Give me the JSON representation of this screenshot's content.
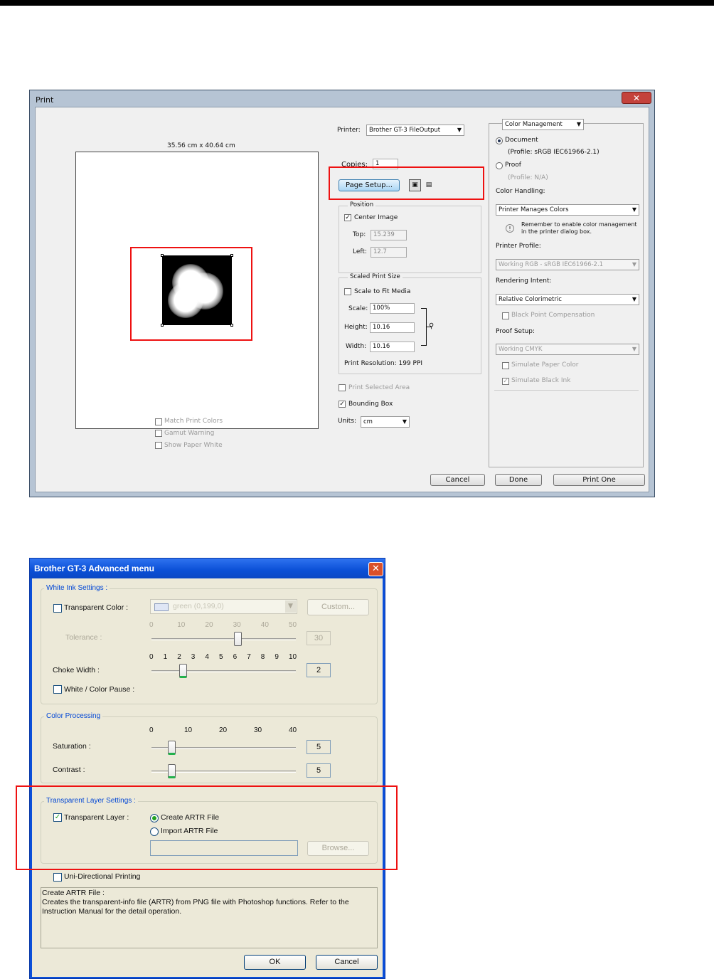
{
  "print_dialog": {
    "title": "Print",
    "close_glyph": "✕",
    "preview_size": "35.56 cm x 40.64 cm",
    "printer_label": "Printer:",
    "printer_value": "Brother GT-3 FileOutput",
    "copies_label": "Copies:",
    "copies_value": "1",
    "page_setup_label": "Page Setup...",
    "position": {
      "title": "Position",
      "center_image_label": "Center Image",
      "center_image_checked": true,
      "top_label": "Top:",
      "top_value": "15.239",
      "left_label": "Left:",
      "left_value": "12.7"
    },
    "scaled": {
      "title": "Scaled Print Size",
      "scale_to_fit_label": "Scale to Fit Media",
      "scale_label": "Scale:",
      "scale_value": "100%",
      "height_label": "Height:",
      "height_value": "10.16",
      "width_label": "Width:",
      "width_value": "10.16",
      "resolution": "Print Resolution: 199 PPI"
    },
    "print_selected_area_label": "Print Selected Area",
    "bounding_box_label": "Bounding Box",
    "bounding_box_checked": true,
    "units_label": "Units:",
    "units_value": "cm",
    "match_print_colors_label": "Match Print Colors",
    "gamut_warning_label": "Gamut Warning",
    "show_paper_white_label": "Show Paper White",
    "color_management": {
      "dropdown_value": "Color Management",
      "document_label": "Document",
      "document_profile": "(Profile: sRGB IEC61966-2.1)",
      "proof_label": "Proof",
      "proof_profile": "(Profile: N/A)",
      "color_handling_label": "Color Handling:",
      "color_handling_value": "Printer Manages Colors",
      "reminder": "Remember to enable color management in the printer dialog box.",
      "info_glyph": "!",
      "printer_profile_label": "Printer Profile:",
      "printer_profile_value": "Working RGB - sRGB IEC61966-2.1",
      "rendering_intent_label": "Rendering Intent:",
      "rendering_intent_value": "Relative Colorimetric",
      "black_point_label": "Black Point Compensation",
      "proof_setup_label": "Proof Setup:",
      "proof_setup_value": "Working CMYK",
      "simulate_paper_label": "Simulate Paper Color",
      "simulate_black_label": "Simulate Black Ink"
    },
    "cancel_label": "Cancel",
    "done_label": "Done",
    "print_one_label": "Print One"
  },
  "advanced_menu": {
    "title": "Brother GT-3 Advanced menu",
    "close_glyph": "✕",
    "white_ink": {
      "title": "White Ink Settings :",
      "transparent_color_label": "Transparent Color :",
      "color_value": "green (0,199,0)",
      "custom_label": "Custom...",
      "tolerance_label": "Tolerance :",
      "tolerance_ticks": [
        "0",
        "10",
        "20",
        "30",
        "40",
        "50"
      ],
      "tolerance_value": "30",
      "choke_width_label": "Choke Width :",
      "choke_ticks": [
        "0",
        "1",
        "2",
        "3",
        "4",
        "5",
        "6",
        "7",
        "8",
        "9",
        "10"
      ],
      "choke_value": "2",
      "white_color_pause_label": "White / Color Pause :"
    },
    "color_processing": {
      "title": "Color Processing",
      "ticks": [
        "0",
        "10",
        "20",
        "30",
        "40"
      ],
      "saturation_label": "Saturation :",
      "saturation_value": "5",
      "contrast_label": "Contrast :",
      "contrast_value": "5"
    },
    "transparent_layer": {
      "title": "Transparent Layer Settings :",
      "transparent_layer_label": "Transparent Layer :",
      "checked": true,
      "create_label": "Create ARTR File",
      "import_label": "Import ARTR File",
      "browse_label": "Browse..."
    },
    "uni_directional_label": "Uni-Directional Printing",
    "description_title": "Create ARTR File :",
    "description_text": "Creates the transparent-info file (ARTR) from PNG file with Photoshop functions. Refer to the Instruction Manual for the detail operation.",
    "ok_label": "OK",
    "cancel_label": "Cancel"
  },
  "colors": {
    "highlight_red": "#ee1111",
    "xp_title_blue": "#0a4fd6",
    "group_title_blue": "#0046d5"
  }
}
